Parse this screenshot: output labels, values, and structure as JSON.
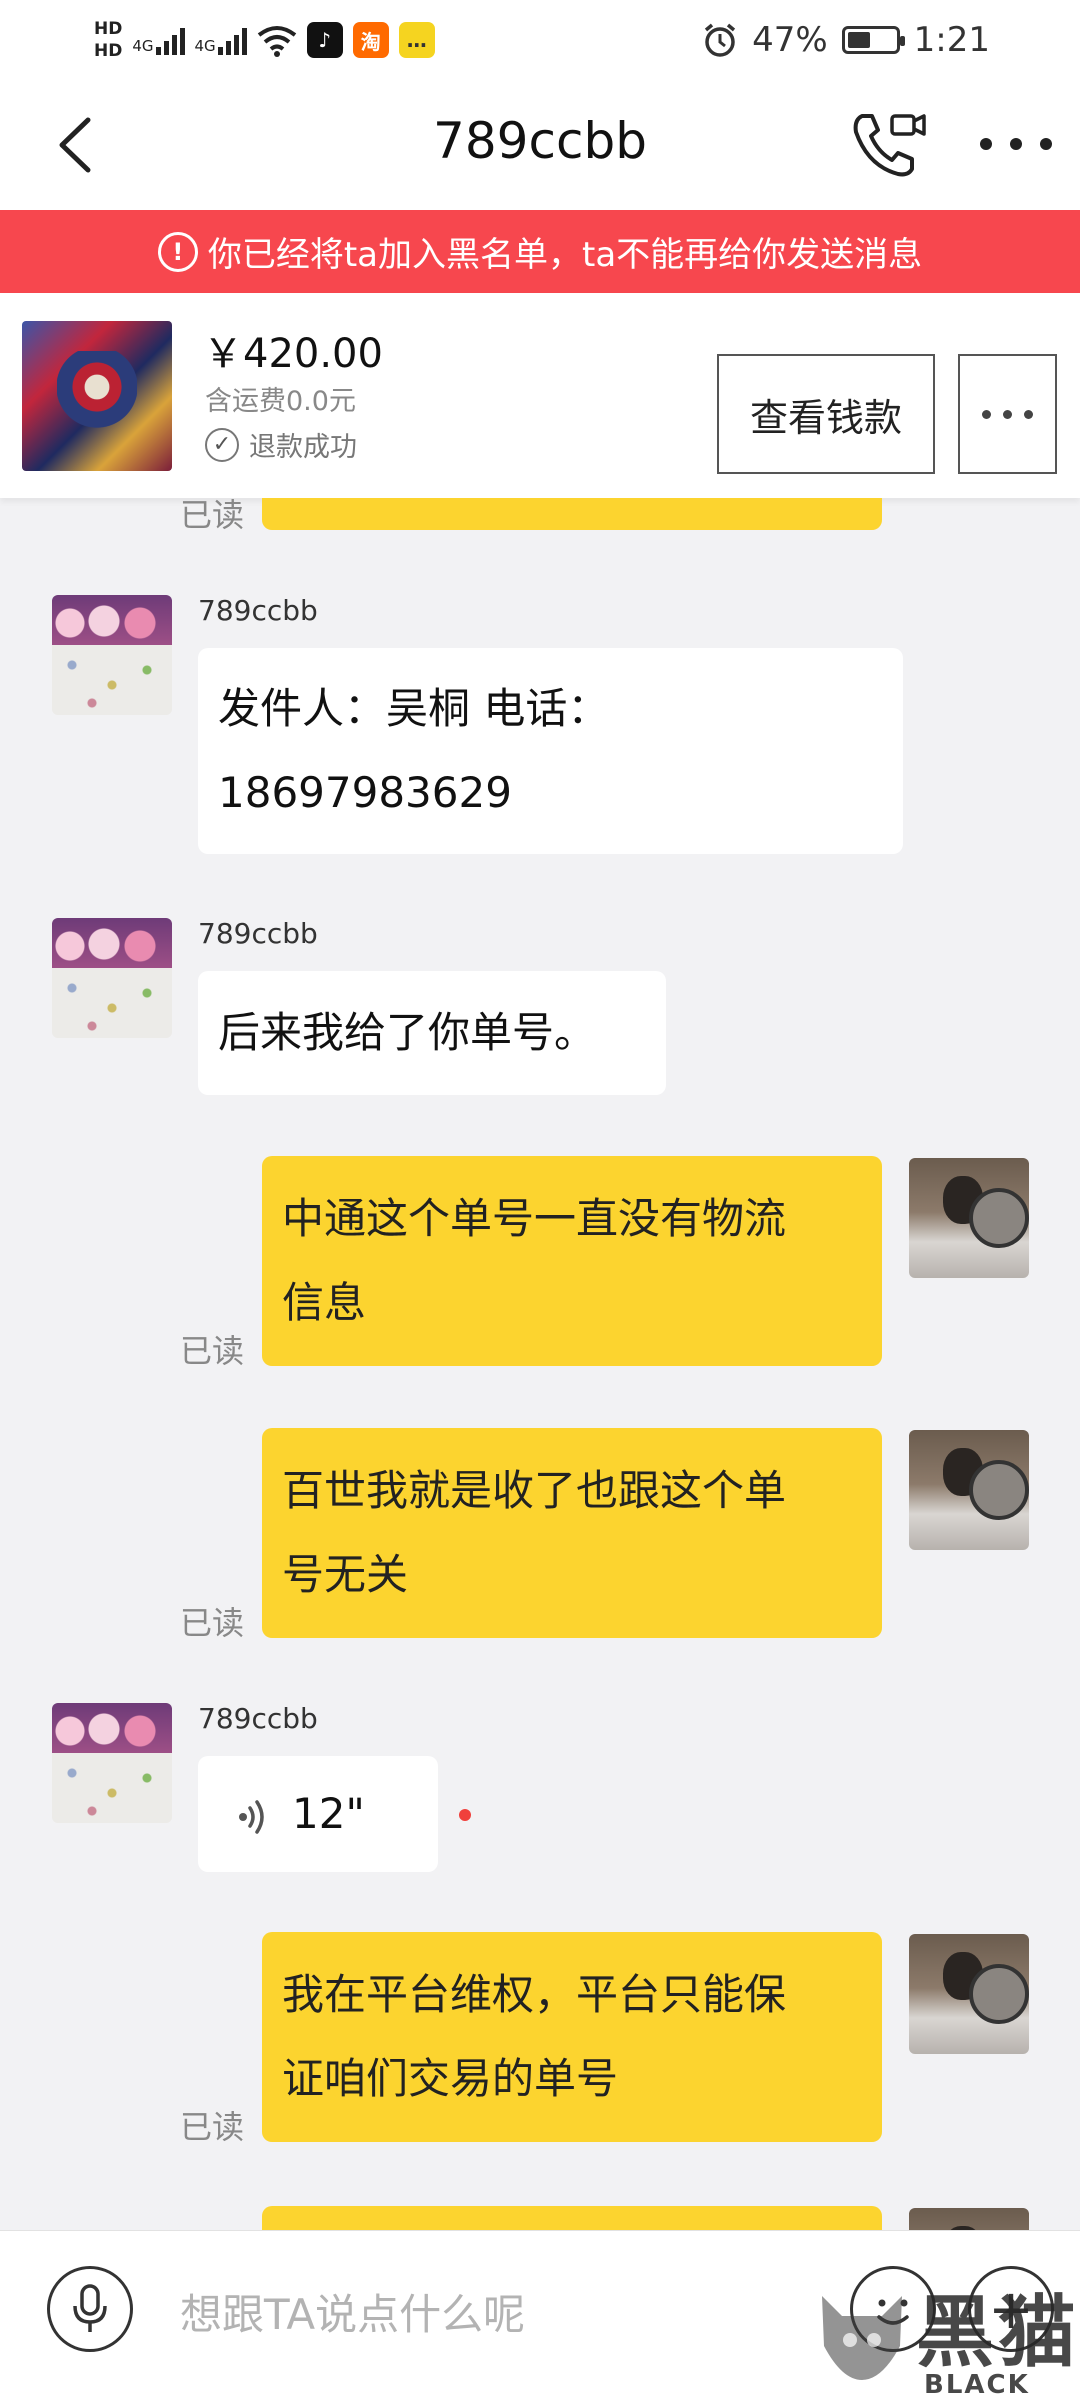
{
  "status_bar": {
    "hd1": "HD",
    "hd2": "HD",
    "net1": "4G",
    "net2": "4G",
    "battery_percent": "47%",
    "battery_level": 0.47,
    "time": "1:21",
    "apps": [
      "tiktok-icon",
      "taobao-icon",
      "chat-icon"
    ],
    "taobao_label": "淘"
  },
  "header": {
    "title": "789ccbb"
  },
  "banner": {
    "text": "你已经将ta加入黑名单，ta不能再给你发送消息",
    "color": "#f7474e"
  },
  "product": {
    "price": "￥420.00",
    "shipping": "含运费0.0元",
    "status": "退款成功",
    "view_button": "查看钱款"
  },
  "messages": [
    {
      "from": "me",
      "read": "已读",
      "lines": []
    },
    {
      "from": "them",
      "sender": "789ccbb",
      "lines": [
        "发件人：吴桐 电话：",
        "18697983629"
      ]
    },
    {
      "from": "them",
      "sender": "789ccbb",
      "lines": [
        "后来我给了你单号。"
      ]
    },
    {
      "from": "me",
      "read": "已读",
      "lines": [
        "中通这个单号一直没有物流",
        "信息"
      ]
    },
    {
      "from": "me",
      "read": "已读",
      "lines": [
        "百世我就是收了也跟这个单",
        "号无关"
      ]
    },
    {
      "from": "them",
      "sender": "789ccbb",
      "voice_duration": "12\""
    },
    {
      "from": "me",
      "read": "已读",
      "lines": [
        "我在平台维权，平台只能保",
        "证咱们交易的单号"
      ]
    }
  ],
  "input": {
    "placeholder": "想跟TA说点什么呢"
  },
  "watermark": {
    "cn": "黑猫",
    "en": "BLACK CAT"
  },
  "colors": {
    "outgoing_bubble": "#fcd42f",
    "incoming_bubble": "#ffffff",
    "background": "#f2f2f4"
  }
}
